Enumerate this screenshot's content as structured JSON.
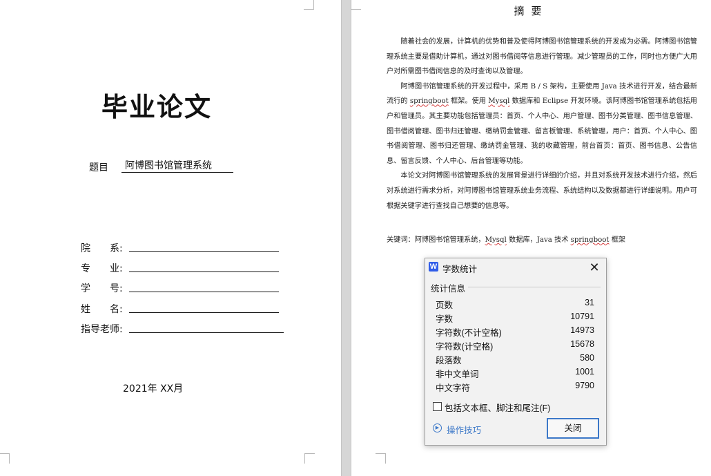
{
  "cover": {
    "thesis_title": "毕业论文",
    "topic_label": "题目",
    "topic_value": "阿博图书馆管理系统",
    "fields": [
      {
        "label": "院　　系:"
      },
      {
        "label": "专　　业:"
      },
      {
        "label": "学　　号:"
      },
      {
        "label": "姓　　名:"
      },
      {
        "label": "指导老师:"
      }
    ],
    "date": "2021年  XX月"
  },
  "abstract": {
    "title": "摘要",
    "p1": "随着社会的发展，计算机的优势和普及使得阿博图书馆管理系统的开发成为必需。阿博图书馆管理系统主要是借助计算机，通过对图书借阅等信息进行管理。减少管理员的工作，同时也方便广大用户对所需图书借阅信息的及时查询以及管理。",
    "p2_a": "阿博图书馆管理系统的开发过程中，采用 B / S 架构，主要使用 Java 技术进行开发，结合最新流行的 ",
    "p2_sb": "springboot",
    "p2_b": " 框架。使用 ",
    "p2_mysql": "Mysql",
    "p2_c": " 数据库和 Eclipse 开发环境。该阿博图书馆管理系统包括用户和管理员。其主要功能包括管理员：首页、个人中心、用户管理、图书分类管理、图书信息管理、图书借阅管理、图书归还管理、缴纳罚金管理、留言板管理、系统管理，用户：首页、个人中心、图书借阅管理、图书归还管理、缴纳罚金管理、我的收藏管理，前台首页：首页、图书信息、公告信息、留言反馈、个人中心、后台管理等功能。",
    "p3": "本论文对阿博图书馆管理系统的发展背景进行详细的介绍，并且对系统开发技术进行介绍，然后对系统进行需求分析，对阿博图书馆管理系统业务流程、系统结构以及数据都进行详细说明。用户可根据关键字进行查找自己想要的信息等。",
    "kw_a": "关键词：阿博图书馆管理系统，",
    "kw_mysql": "Mysql",
    "kw_b": " 数据库，Java 技术  ",
    "kw_sb": "springboot",
    "kw_c": " 框架"
  },
  "dialog": {
    "app_icon": "W",
    "title": "字数统计",
    "close_glyph": "✕",
    "group_label": "统计信息",
    "stats": [
      {
        "label": "页数",
        "value": "31"
      },
      {
        "label": "字数",
        "value": "10791"
      },
      {
        "label": "字符数(不计空格)",
        "value": "14973"
      },
      {
        "label": "字符数(计空格)",
        "value": "15678"
      },
      {
        "label": "段落数",
        "value": "580"
      },
      {
        "label": "非中文单词",
        "value": "1001"
      },
      {
        "label": "中文字符",
        "value": "9790"
      }
    ],
    "checkbox_label": "包括文本框、脚注和尾注(F)",
    "checkbox_checked": false,
    "tips_link": "操作技巧",
    "close_button": "关闭",
    "accent_color": "#3c78c8"
  }
}
